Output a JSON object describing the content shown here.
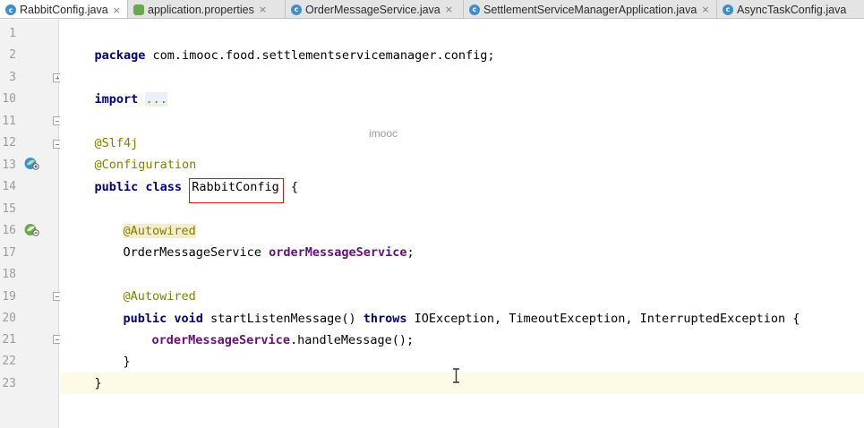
{
  "tabs": [
    {
      "label": "RabbitConfig.java",
      "icon": "java-class-icon",
      "active": true
    },
    {
      "label": "application.properties",
      "icon": "properties-file-icon",
      "active": false
    },
    {
      "label": "OrderMessageService.java",
      "icon": "java-class-icon",
      "active": false
    },
    {
      "label": "SettlementServiceManagerApplication.java",
      "icon": "java-class-icon",
      "active": false
    },
    {
      "label": "AsyncTaskConfig.java",
      "icon": "java-class-icon",
      "active": false
    }
  ],
  "tab_icon_letter": "c",
  "tab_close_glyph": "×",
  "line_numbers": [
    "1",
    "2",
    "3",
    "10",
    "11",
    "12",
    "13",
    "14",
    "15",
    "16",
    "17",
    "18",
    "19",
    "20",
    "21",
    "22",
    "23"
  ],
  "code": {
    "l1_kw": "package",
    "l1_rest": " com.imooc.food.settlementservicemanager.config;",
    "l3_kw": "import",
    "l3_dots": "...",
    "l11_ann": "@Slf4j",
    "l12_ann": "@Configuration",
    "l13_kw": "public class",
    "l13_class": "RabbitConfig",
    "l13_brace": " {",
    "l15_ann": "@Autowired",
    "l16_type": "OrderMessageService",
    "l16_field": "orderMessageService",
    "l16_semi": ";",
    "l18_ann": "@Autowired",
    "l19_kw1": "public void",
    "l19_method": " startListenMessage() ",
    "l19_kw2": "throws",
    "l19_rest": " IOException, TimeoutException, InterruptedException {",
    "l20_field": "orderMessageService",
    "l20_rest": ".handleMessage();",
    "l21": "}",
    "l22": "}"
  },
  "watermark": "imooc",
  "colors": {
    "keyword": "#000080",
    "annotation": "#808000",
    "field": "#660e7a",
    "highlight_box": "#c41e1e",
    "current_line": "#fdfbe8"
  }
}
